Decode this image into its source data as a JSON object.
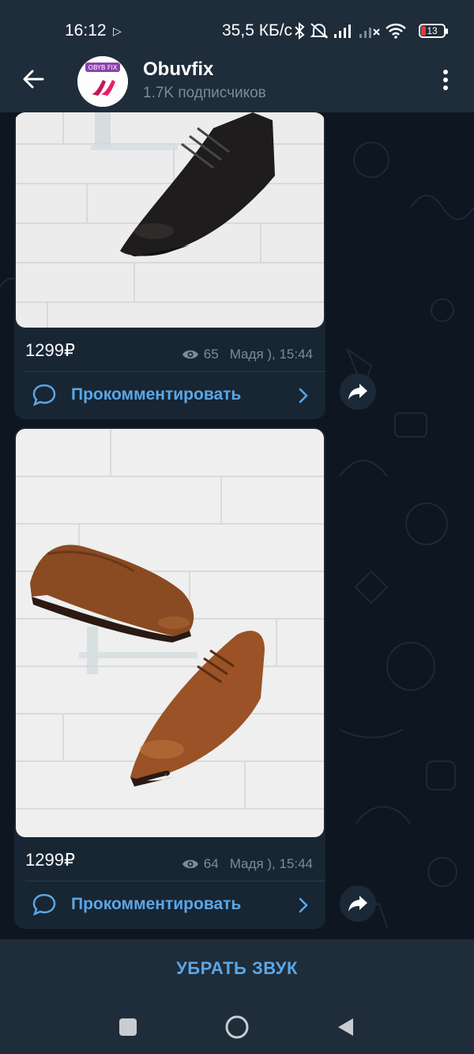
{
  "status_bar": {
    "time": "16:12",
    "network_speed": "35,5 КБ/с",
    "battery_level": "13",
    "icons": [
      "play-icon",
      "bluetooth-icon",
      "mute-icon",
      "signal-icon",
      "signal-no-service-icon",
      "wifi-icon",
      "battery-icon"
    ]
  },
  "header": {
    "title": "Obuvfix",
    "subscribers": "1.7K подписчиков",
    "avatar_text": "OBYB FIX",
    "icons": [
      "back-arrow-icon",
      "more-vertical-icon"
    ]
  },
  "messages": [
    {
      "price": "1299₽",
      "views": "65",
      "author_time": "Мадя ), 15:44",
      "comment_label": "Прокомментировать",
      "photo": "black leather derby shoe"
    },
    {
      "price": "1299₽",
      "views": "64",
      "author_time": "Мадя ), 15:44",
      "comment_label": "Прокомментировать",
      "photo": "brown leather wingtip oxford shoes"
    }
  ],
  "mute_button": {
    "label": "УБРАТЬ ЗВУК"
  },
  "colors": {
    "background": "#0e1621",
    "bar": "#1f2c3a",
    "bubble": "#182533",
    "accent": "#5aa7e6",
    "muted_text": "#7d8b99"
  }
}
